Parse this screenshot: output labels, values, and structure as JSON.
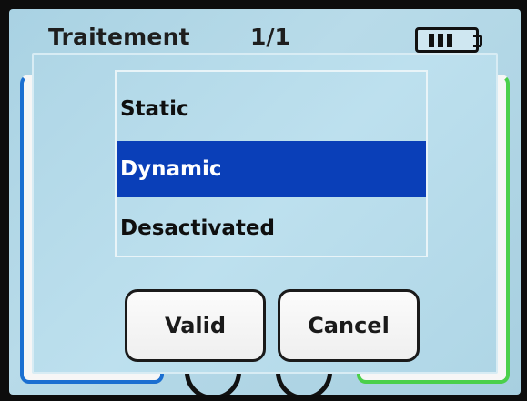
{
  "header": {
    "title": "Traitement",
    "page": "1/1"
  },
  "dialog": {
    "options": [
      {
        "label": "Static",
        "selected": false
      },
      {
        "label": "Dynamic",
        "selected": true
      },
      {
        "label": "Desactivated",
        "selected": false
      }
    ],
    "buttons": {
      "valid_label": "Valid",
      "cancel_label": "Cancel"
    }
  },
  "colors": {
    "screen_bg": "#b3d8e8",
    "selection": "#0a3fb8",
    "left_tile_border": "#1b6fd1",
    "right_tile_border": "#4bd04b"
  },
  "icons": {
    "status": "battery-icon"
  }
}
